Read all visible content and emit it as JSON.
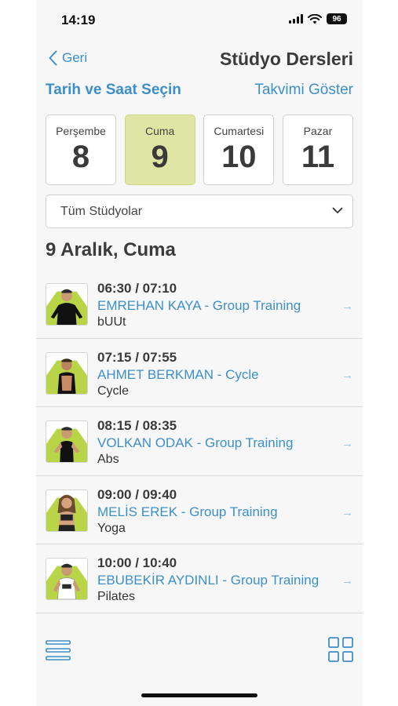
{
  "status_bar": {
    "time": "14:19",
    "battery": "96"
  },
  "nav": {
    "back_label": "Geri",
    "title": "Stüdyo Dersleri"
  },
  "subheader": {
    "left": "Tarih ve Saat Seçin",
    "right": "Takvimi Göster"
  },
  "days": [
    {
      "name": "Perşembe",
      "number": "8",
      "selected": false
    },
    {
      "name": "Cuma",
      "number": "9",
      "selected": true
    },
    {
      "name": "Cumartesi",
      "number": "10",
      "selected": false
    },
    {
      "name": "Pazar",
      "number": "11",
      "selected": false
    }
  ],
  "studio_select": {
    "value": "Tüm Stüdyolar"
  },
  "date_title": "9 Aralık, Cuma",
  "lessons": [
    {
      "time": "06:30 / 07:10",
      "title": "EMREHAN KAYA - Group Training",
      "type": "bUUt",
      "arrow": "→"
    },
    {
      "time": "07:15 / 07:55",
      "title": "AHMET BERKMAN - Cycle",
      "type": "Cycle",
      "arrow": "→"
    },
    {
      "time": "08:15 / 08:35",
      "title": "VOLKAN ODAK - Group Training",
      "type": "Abs",
      "arrow": "→"
    },
    {
      "time": "09:00 / 09:40",
      "title": "MELİS EREK - Group Training",
      "type": "Yoga",
      "arrow": "→"
    },
    {
      "time": "10:00 / 10:40",
      "title": "EBUBEKİR AYDINLI - Group Training",
      "type": "Pilates",
      "arrow": "→"
    }
  ],
  "colors": {
    "accent": "#3d8fc9",
    "selected_day": "#dfe6a3",
    "avatar_accent": "#b9d446"
  },
  "icons": {
    "back": "chevron-left-icon",
    "dropdown": "chevron-down-icon",
    "menu": "hamburger-menu-icon",
    "grid": "grid-view-icon"
  }
}
